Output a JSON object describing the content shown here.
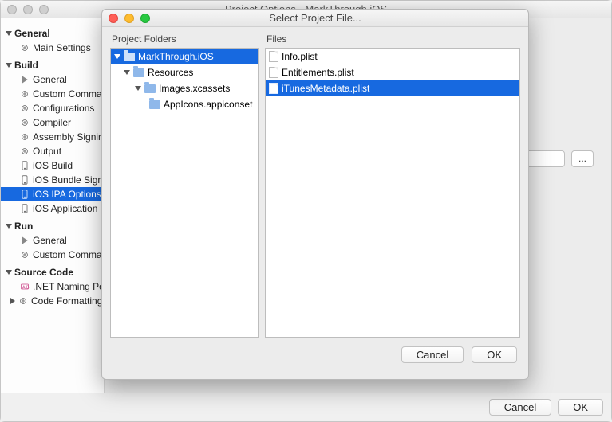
{
  "parent_window": {
    "title": "Project Options - MarkThrough.iOS",
    "footer": {
      "cancel": "Cancel",
      "ok": "OK"
    }
  },
  "sidebar": {
    "categories": [
      {
        "label": "General",
        "items": [
          "Main Settings"
        ]
      },
      {
        "label": "Build",
        "items": [
          "General",
          "Custom Commands",
          "Configurations",
          "Compiler",
          "Assembly Signing",
          "Output",
          "iOS Build",
          "iOS Bundle Signing",
          "iOS IPA Options",
          "iOS Application"
        ]
      },
      {
        "label": "Run",
        "items": [
          "General",
          "Custom Commands"
        ]
      },
      {
        "label": "Source Code",
        "items": [
          ".NET Naming Policies",
          "Code Formatting"
        ]
      }
    ],
    "active": "iOS IPA Options"
  },
  "browse_button": "...",
  "dialog": {
    "title": "Select Project File...",
    "folders_header": "Project Folders",
    "files_header": "Files",
    "tree": [
      {
        "label": "MarkThrough.iOS",
        "depth": 0,
        "expanded": true,
        "selected": true
      },
      {
        "label": "Resources",
        "depth": 1,
        "expanded": true
      },
      {
        "label": "Images.xcassets",
        "depth": 2,
        "expanded": true
      },
      {
        "label": "AppIcons.appiconset",
        "depth": 3,
        "expanded": false
      }
    ],
    "files": [
      {
        "label": "Info.plist",
        "selected": false
      },
      {
        "label": "Entitlements.plist",
        "selected": false
      },
      {
        "label": "iTunesMetadata.plist",
        "selected": true
      }
    ],
    "footer": {
      "cancel": "Cancel",
      "ok": "OK"
    }
  }
}
